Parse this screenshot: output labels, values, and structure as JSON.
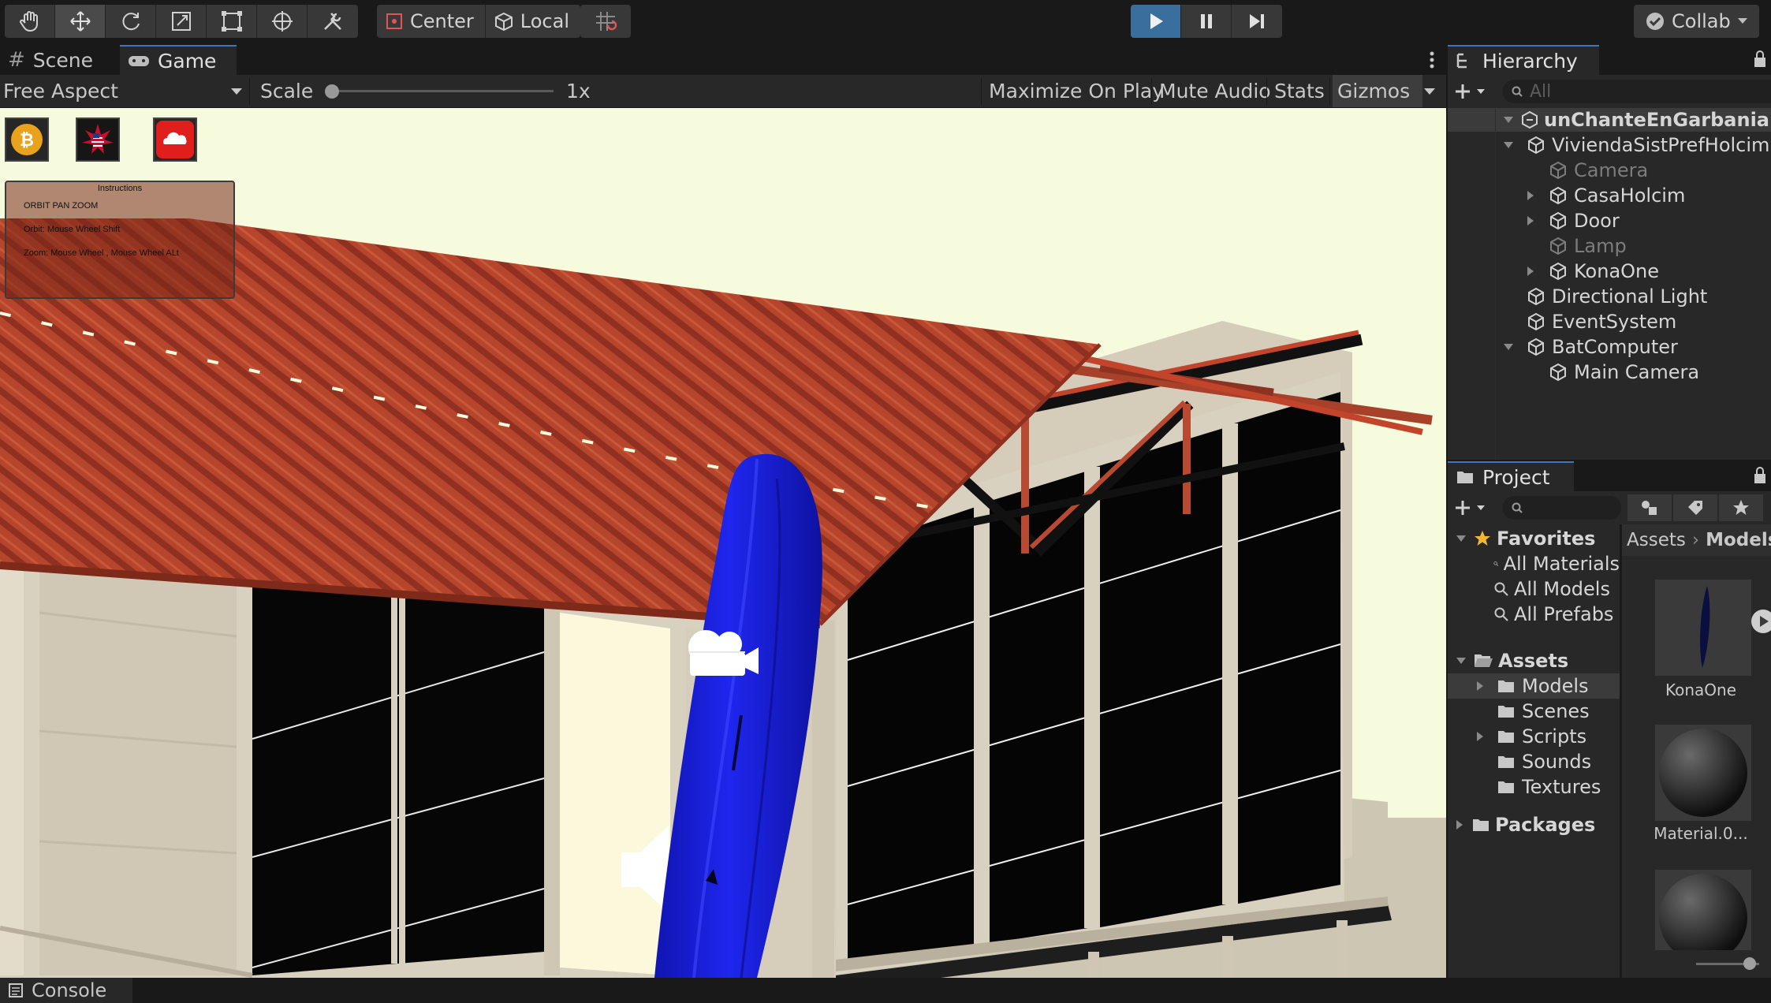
{
  "toolbar": {
    "pivot_label": "Center",
    "space_label": "Local",
    "collab_label": "Collab"
  },
  "game_panel": {
    "tabs": [
      "Scene",
      "Game"
    ],
    "aspect": "Free Aspect",
    "scale_label": "Scale",
    "scale_value": "1x",
    "scale_slider": 0.0,
    "maximize_label": "Maximize On Play",
    "mute_label": "Mute Audio",
    "stats_label": "Stats",
    "gizmos_label": "Gizmos"
  },
  "overlay": {
    "instructions_title": "Instructions",
    "lines": [
      "ORBIT PAN ZOOM",
      "Orbit: Mouse Wheel Shift",
      "Zoom: Mouse Wheel , Mouse Wheel ALt"
    ]
  },
  "hierarchy": {
    "title": "Hierarchy",
    "search_placeholder": "All",
    "scene_name": "unChanteEnGarbania",
    "items": [
      {
        "label": "ViviendaSistPrefHolcim",
        "depth": 1,
        "expand": "open",
        "dim": false
      },
      {
        "label": "Camera",
        "depth": 2,
        "expand": "none",
        "dim": true
      },
      {
        "label": "CasaHolcim",
        "depth": 2,
        "expand": "closed",
        "dim": false
      },
      {
        "label": "Door",
        "depth": 2,
        "expand": "closed",
        "dim": false
      },
      {
        "label": "Lamp",
        "depth": 2,
        "expand": "none",
        "dim": true
      },
      {
        "label": "KonaOne",
        "depth": 2,
        "expand": "closed",
        "dim": false
      },
      {
        "label": "Directional Light",
        "depth": 1,
        "expand": "none",
        "dim": false
      },
      {
        "label": "EventSystem",
        "depth": 1,
        "expand": "none",
        "dim": false
      },
      {
        "label": "BatComputer",
        "depth": 1,
        "expand": "open",
        "dim": false
      },
      {
        "label": "Main Camera",
        "depth": 2,
        "expand": "none",
        "dim": false
      }
    ]
  },
  "project": {
    "title": "Project",
    "favorites_label": "Favorites",
    "favorites": [
      "All Materials",
      "All Models",
      "All Prefabs"
    ],
    "assets_label": "Assets",
    "folders": [
      {
        "label": "Models",
        "expand": "closed",
        "selected": true
      },
      {
        "label": "Scenes",
        "expand": "none",
        "selected": false
      },
      {
        "label": "Scripts",
        "expand": "closed",
        "selected": false
      },
      {
        "label": "Sounds",
        "expand": "none",
        "selected": false
      },
      {
        "label": "Textures",
        "expand": "none",
        "selected": false
      }
    ],
    "packages_label": "Packages",
    "breadcrumb": [
      "Assets",
      "Models"
    ],
    "grid_items": [
      "KonaOne",
      "Material.0..."
    ]
  },
  "console": {
    "tab_label": "Console"
  },
  "colors": {
    "roof": "#b3442a",
    "surfboard": "#1a1fe0",
    "sky": "#f5fbdc",
    "accent": "#3a79bb",
    "wall": "#d9d1bf"
  }
}
